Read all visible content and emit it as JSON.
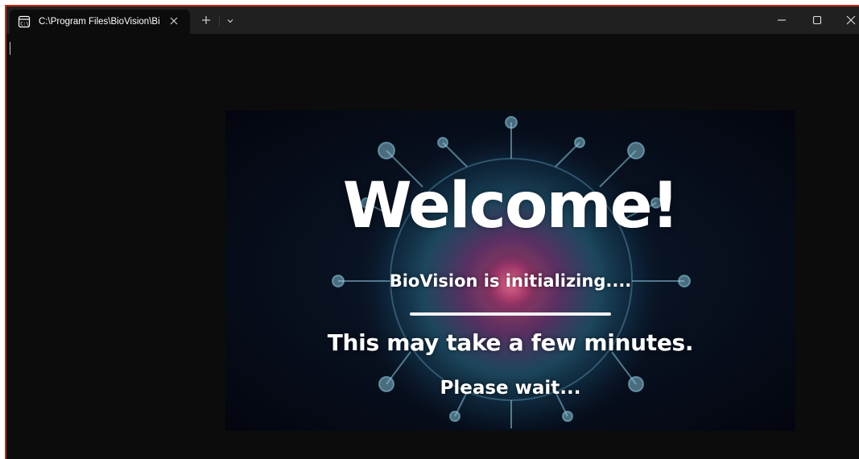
{
  "window": {
    "tab_title": "C:\\Program Files\\BioVision\\Bi",
    "accent_border": "#c42b1c",
    "background": "#0c0c0c"
  },
  "icons": {
    "tab": "terminal-icon",
    "close_tab": "close-icon",
    "new_tab": "plus-icon",
    "dropdown": "chevron-down-icon",
    "minimize": "minimize-icon",
    "maximize": "maximize-icon",
    "close_window": "close-icon"
  },
  "splash": {
    "welcome": "Welcome!",
    "initializing": "BioVision is initializing....",
    "notice": "This may take a few minutes.",
    "wait": "Please wait..."
  }
}
